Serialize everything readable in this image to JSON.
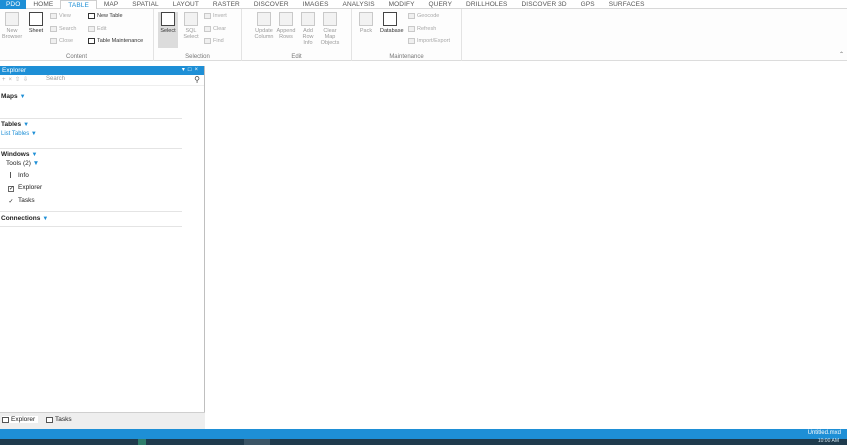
{
  "tabs": {
    "file": "PDO",
    "home": "HOME",
    "table": "TABLE",
    "map": "MAP",
    "spatial": "SPATIAL",
    "layout": "LAYOUT",
    "raster": "RASTER",
    "discover": "DISCOVER",
    "images": "IMAGES",
    "analysis": "ANALYSIS",
    "modify": "MODIFY",
    "query": "QUERY",
    "drillholes": "DRILLHOLES",
    "discover3d": "DISCOVER 3D",
    "gps": "GPS",
    "surfaces": "SURFACES"
  },
  "ribbon": {
    "content": {
      "label": "Content",
      "new_browser": "New Browser",
      "sheet": "Sheet",
      "view": "View",
      "search": "Search",
      "close": "Close",
      "new_table": "New Table",
      "edit": "Edit",
      "table_maintenance": "Table Maintenance"
    },
    "selection": {
      "label": "Selection",
      "select": "Select",
      "sql_select": "SQL Select",
      "invert": "Invert",
      "clear": "Clear",
      "find": "Find"
    },
    "edit": {
      "label": "Edit",
      "update_column": "Update Column",
      "append_rows": "Append Rows",
      "add_row": "Add Row Info",
      "clear_map_objects": "Clear Map Objects"
    },
    "maintenance": {
      "label": "Maintenance",
      "pack": "Pack",
      "database": "Database",
      "geocode": "Geocode",
      "refresh": "Refresh",
      "import_export": "Import/Export"
    }
  },
  "explorer": {
    "title": "Explorer",
    "search_placeholder": "Search",
    "sections": {
      "maps": "Maps",
      "tables": "Tables",
      "tables_sub": "List Tables",
      "windows": "Windows",
      "tools": "Tools (2)",
      "info": "Info",
      "explorer_item": "Explorer",
      "tasks_item": "Tasks",
      "connections": "Connections"
    },
    "bottom_tabs": {
      "explorer": "Explorer",
      "tasks": "Tasks"
    }
  },
  "statusbar": {
    "right_text": "Untitled.mxd"
  },
  "taskbar": {
    "clock": "10:00 AM"
  },
  "colors": {
    "accent": "#1e8fd6",
    "taskbar": "#1f3b4d"
  }
}
